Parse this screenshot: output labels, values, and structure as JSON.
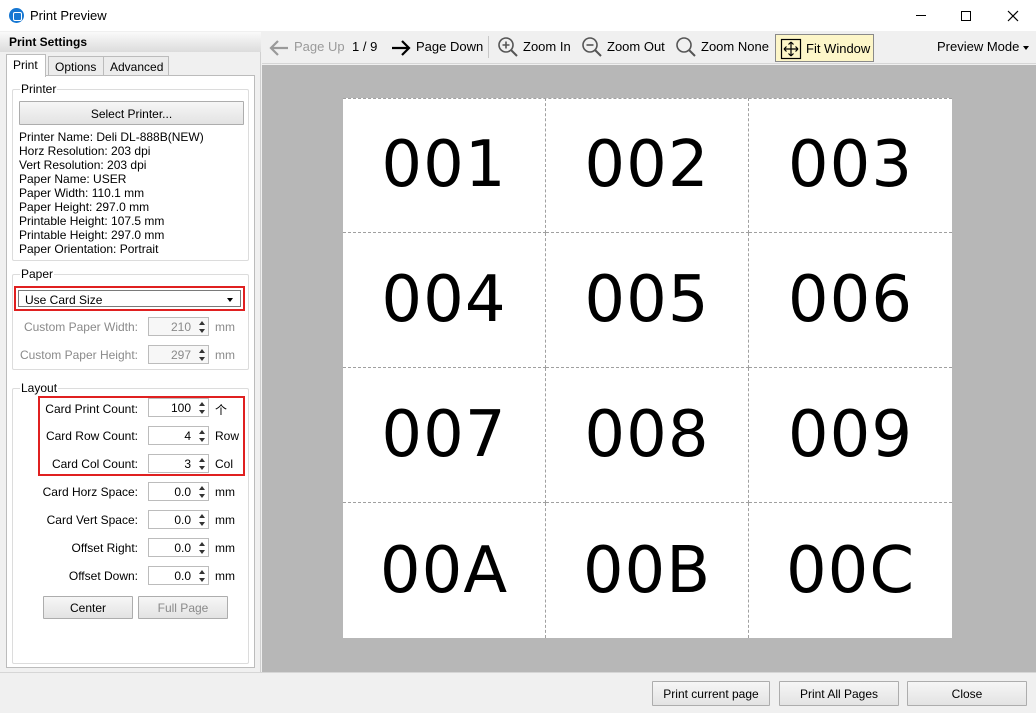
{
  "window": {
    "title": "Print Preview"
  },
  "settings": {
    "header": "Print Settings",
    "tabs": [
      "Print",
      "Options",
      "Advanced"
    ],
    "printer": {
      "group_label": "Printer",
      "select_button": "Select Printer...",
      "info": [
        "Printer Name: Deli DL-888B(NEW)",
        "Horz Resolution: 203 dpi",
        "Vert Resolution: 203 dpi",
        "Paper Name: USER",
        "Paper Width: 110.1 mm",
        "Paper Height: 297.0 mm",
        "Printable Height: 107.5 mm",
        "Printable Height: 297.0 mm",
        "Paper Orientation: Portrait"
      ]
    },
    "paper": {
      "group_label": "Paper",
      "size_option": "Use Card Size",
      "custom_width": {
        "label": "Custom Paper Width:",
        "value": "210",
        "unit": "mm"
      },
      "custom_height": {
        "label": "Custom Paper Height:",
        "value": "297",
        "unit": "mm"
      }
    },
    "layout": {
      "group_label": "Layout",
      "rows": [
        {
          "label": "Card Print Count:",
          "value": "100",
          "unit": "个"
        },
        {
          "label": "Card Row Count:",
          "value": "4",
          "unit": "Row"
        },
        {
          "label": "Card Col Count:",
          "value": "3",
          "unit": "Col"
        },
        {
          "label": "Card Horz Space:",
          "value": "0.0",
          "unit": "mm"
        },
        {
          "label": "Card Vert Space:",
          "value": "0.0",
          "unit": "mm"
        },
        {
          "label": "Offset Right:",
          "value": "0.0",
          "unit": "mm"
        },
        {
          "label": "Offset Down:",
          "value": "0.0",
          "unit": "mm"
        }
      ],
      "center_button": "Center",
      "full_page_button": "Full Page"
    }
  },
  "toolbar": {
    "page_up": "Page Up",
    "page_indicator": "1 / 9",
    "page_down": "Page Down",
    "zoom_in": "Zoom In",
    "zoom_out": "Zoom Out",
    "zoom_none": "Zoom None",
    "fit_window": "Fit Window",
    "preview_mode": "Preview Mode"
  },
  "preview": {
    "cards": [
      "001",
      "002",
      "003",
      "004",
      "005",
      "006",
      "007",
      "008",
      "009",
      "00A",
      "00B",
      "00C"
    ]
  },
  "footer": {
    "print_current": "Print current page",
    "print_all": "Print All Pages",
    "close": "Close"
  }
}
